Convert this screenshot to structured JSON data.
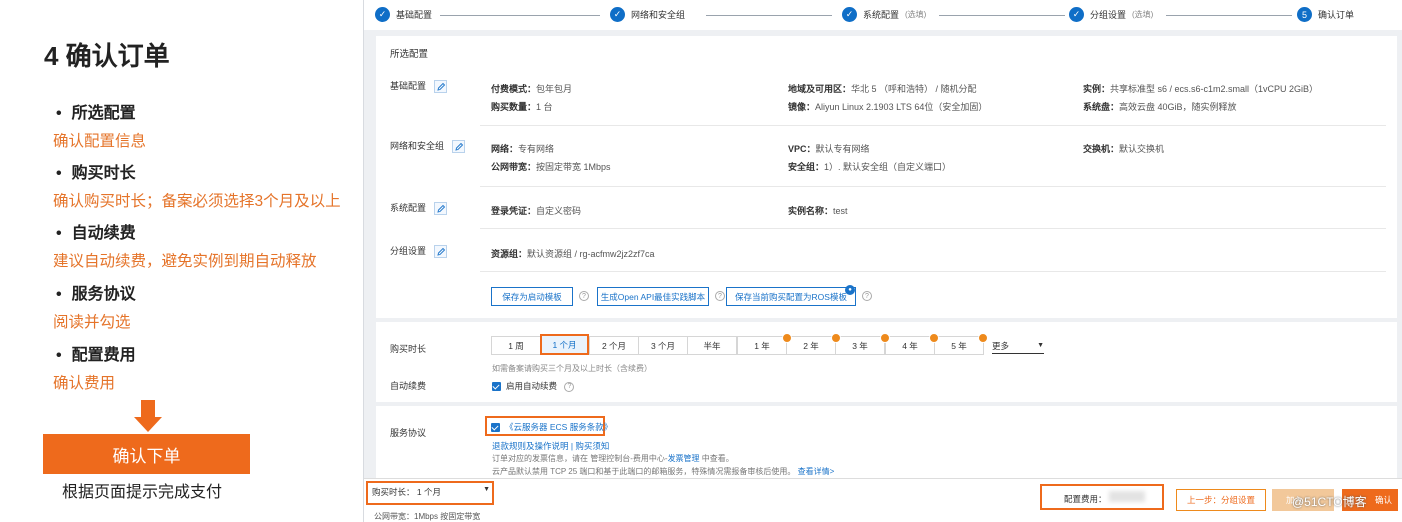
{
  "left": {
    "title": "4 确认订单",
    "sections": [
      {
        "title": "所选配置",
        "desc": "确认配置信息"
      },
      {
        "title": "购买时长",
        "desc": "确认购买时长；备案必须选择3个月及以上"
      },
      {
        "title": "自动续费",
        "desc": "建议自动续费，避免实例到期自动释放"
      },
      {
        "title": "服务协议",
        "desc": "阅读并勾选"
      },
      {
        "title": "配置费用",
        "desc": "确认费用"
      }
    ],
    "confirm_button": "确认下单",
    "follow_tip": "根据页面提示完成支付"
  },
  "steps": [
    {
      "label": "基础配置",
      "optional": ""
    },
    {
      "label": "网络和安全组",
      "optional": ""
    },
    {
      "label": "系统配置",
      "optional": "(选填)"
    },
    {
      "label": "分组设置",
      "optional": "(选填)"
    },
    {
      "label": "确认订单",
      "optional": "",
      "number": "5"
    }
  ],
  "selected_config": {
    "header": "所选配置",
    "basic": {
      "label": "基础配置",
      "billing_key": "付费模式：",
      "billing_val": "包年包月",
      "region_key": "地域及可用区：",
      "region_val": "华北 5 （呼和浩特） / 随机分配",
      "instance_key": "实例：",
      "instance_val": "共享标准型 s6 / ecs.s6-c1m2.small（1vCPU 2GiB）",
      "count_key": "购买数量：",
      "count_val": "1 台",
      "image_key": "镜像：",
      "image_val": "Aliyun Linux 2.1903 LTS 64位（安全加固）",
      "disk_key": "系统盘：",
      "disk_val": "高效云盘 40GiB，随实例释放"
    },
    "network": {
      "label": "网络和安全组",
      "net_key": "网络：",
      "net_val": "专有网络",
      "vpc_key": "VPC：",
      "vpc_val": "默认专有网络",
      "vswitch_key": "交换机：",
      "vswitch_val": "默认交换机",
      "bandwidth_key": "公网带宽：",
      "bandwidth_val": "按固定带宽 1Mbps",
      "sg_key": "安全组：",
      "sg_val": "1）. 默认安全组（自定义端口）"
    },
    "system": {
      "label": "系统配置",
      "login_key": "登录凭证：",
      "login_val": "自定义密码",
      "name_key": "实例名称：",
      "name_val": "test"
    },
    "group": {
      "label": "分组设置",
      "rg_key": "资源组：",
      "rg_val": "默认资源组 / rg-acfmw2jz2zf7ca"
    },
    "buttons": {
      "save_template": "保存为启动模板",
      "gen_api": "生成Open API最佳实践脚本",
      "save_ros": "保存当前购买配置为ROS模板"
    }
  },
  "purchase": {
    "duration_label": "购买时长",
    "options": [
      "1 周",
      "1 个月",
      "2 个月",
      "3 个月",
      "半年",
      "1 年",
      "2 年",
      "3 年",
      "4 年",
      "5 年"
    ],
    "selected": "1 个月",
    "more": "更多",
    "note": "如需备案请购买三个月及以上时长（含续费）",
    "auto_renew_label": "自动续费",
    "auto_renew_checkbox": "启用自动续费"
  },
  "agreement": {
    "label": "服务协议",
    "checkbox_text": "《云服务器 ECS 服务条款》",
    "links": "退款规则及操作说明 | 购买须知",
    "invoice_note_a": "订单对应的发票信息，请在 管理控制台-费用中心-",
    "invoice_link": "发票管理",
    "invoice_note_b": " 中查看。",
    "port_note": "云产品默认禁用 TCP 25 端口和基于此端口的邮箱服务，特殊情况需报备审核后使用。",
    "port_link": "查看详情>"
  },
  "footer": {
    "duration_select": "购买时长：  1 个月",
    "bandwidth": "公网带宽：1Mbps 按固定带宽",
    "fee_label": "配置费用：",
    "prev_button": "上一步：分组设置",
    "add_button": "加入",
    "confirm_button": "确认",
    "watermark": "@51CTO博客"
  }
}
